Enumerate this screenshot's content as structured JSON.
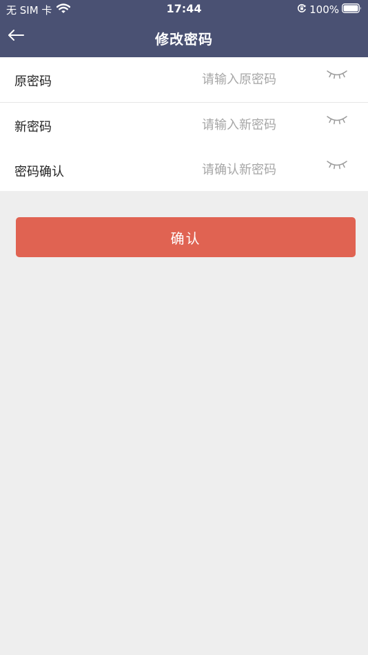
{
  "status_bar": {
    "carrier": "无 SIM 卡",
    "time": "17:44",
    "battery": "100%",
    "icons": [
      "wifi-icon",
      "orientation-lock-icon",
      "battery-icon"
    ]
  },
  "nav": {
    "title": "修改密码",
    "back_icon": "arrow-left-icon"
  },
  "form": {
    "rows": [
      {
        "label": "原密码",
        "placeholder": "请输入原密码",
        "value": "",
        "toggle_icon": "eye-closed-icon"
      },
      {
        "label": "新密码",
        "placeholder": "请输入新密码",
        "value": "",
        "toggle_icon": "eye-closed-icon"
      },
      {
        "label": "密码确认",
        "placeholder": "请确认新密码",
        "value": "",
        "toggle_icon": "eye-closed-icon"
      }
    ]
  },
  "confirm_label": "确认",
  "colors": {
    "header": "#4a5173",
    "button": "#e06352",
    "background": "#eeeeee",
    "placeholder": "#a6a6a6"
  }
}
